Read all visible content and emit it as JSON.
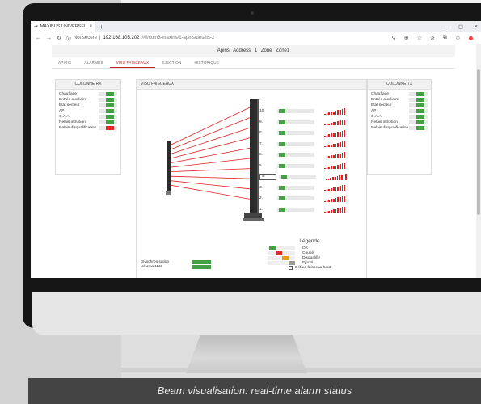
{
  "browser": {
    "tab_title": "MAXIBUS UNIVERSEL",
    "tab_close": "×",
    "new_tab": "+",
    "not_secure": "Not secure",
    "url_host": "192.168.105.202",
    "url_path": "/#!/com3-maxiris/1-apiris/details-2",
    "window_controls": [
      "–",
      "◻",
      "×"
    ]
  },
  "app_header": {
    "device": "Apiris",
    "address": "Address 1",
    "zone": "Zone Zone1"
  },
  "tabs": [
    {
      "label": "APIRIS",
      "active": false
    },
    {
      "label": "ALARMES",
      "active": false
    },
    {
      "label": "VISU FAISCEAUX",
      "active": true
    },
    {
      "label": "EJECTION",
      "active": false
    },
    {
      "label": "HISTORIQUE",
      "active": false
    }
  ],
  "rx_panel": {
    "title": "COLONNE RX",
    "rows": [
      {
        "label": "Chauffage",
        "state": "on"
      },
      {
        "label": "Entrée auxiliaire",
        "state": "on"
      },
      {
        "label": "Etat secteur",
        "state": "on"
      },
      {
        "label": "AP",
        "state": "on"
      },
      {
        "label": "C.A.A.",
        "state": "on"
      },
      {
        "label": "Relais intrusion",
        "state": "on"
      },
      {
        "label": "Relais disqualification",
        "state": "off"
      }
    ]
  },
  "tx_panel": {
    "title": "COLONNE TX",
    "rows": [
      {
        "label": "Chauffage",
        "state": "on"
      },
      {
        "label": "Entrée auxiliaire",
        "state": "on"
      },
      {
        "label": "Etat secteur",
        "state": "on"
      },
      {
        "label": "AP",
        "state": "on"
      },
      {
        "label": "C.A.A.",
        "state": "on"
      },
      {
        "label": "Relais intrusion",
        "state": "on"
      },
      {
        "label": "Relais disqualification",
        "state": "on"
      }
    ]
  },
  "visu_panel": {
    "title": "VISU FAISCEAUX",
    "beams": [
      {
        "num": "10.",
        "state": "on",
        "signal": 10,
        "selected": false
      },
      {
        "num": "9.",
        "state": "on",
        "signal": 10,
        "selected": false
      },
      {
        "num": "8.",
        "state": "on",
        "signal": 10,
        "selected": false
      },
      {
        "num": "7.",
        "state": "on",
        "signal": 10,
        "selected": false
      },
      {
        "num": "6.",
        "state": "on",
        "signal": 10,
        "selected": false
      },
      {
        "num": "5.",
        "state": "on",
        "signal": 10,
        "selected": false
      },
      {
        "num": "4.",
        "state": "on",
        "signal": 10,
        "selected": true
      },
      {
        "num": "3.",
        "state": "on",
        "signal": 10,
        "selected": false
      },
      {
        "num": "2.",
        "state": "on",
        "signal": 10,
        "selected": false
      },
      {
        "num": "1.",
        "state": "on",
        "signal": 10,
        "selected": false
      }
    ],
    "sync_rows": [
      {
        "label": "Synchronisation",
        "state": "on"
      },
      {
        "label": "Alarme MW",
        "state": "on"
      }
    ],
    "legend": {
      "title": "Légende",
      "items": [
        {
          "label": "OK",
          "state": "on"
        },
        {
          "label": "Coupé",
          "state": "off"
        },
        {
          "label": "Disqualifié",
          "state": "warn"
        },
        {
          "label": "Ejecté",
          "state": "grey"
        },
        {
          "label": "Défaut faisceau haut",
          "state": "checkbox"
        }
      ]
    }
  },
  "caption": "Beam visualisation: real-time alarm status",
  "colors": {
    "ok": "#45a045",
    "cut": "#dd2a2a",
    "warn": "#e89b18",
    "ejected": "#999999",
    "beam": "#e02020"
  }
}
